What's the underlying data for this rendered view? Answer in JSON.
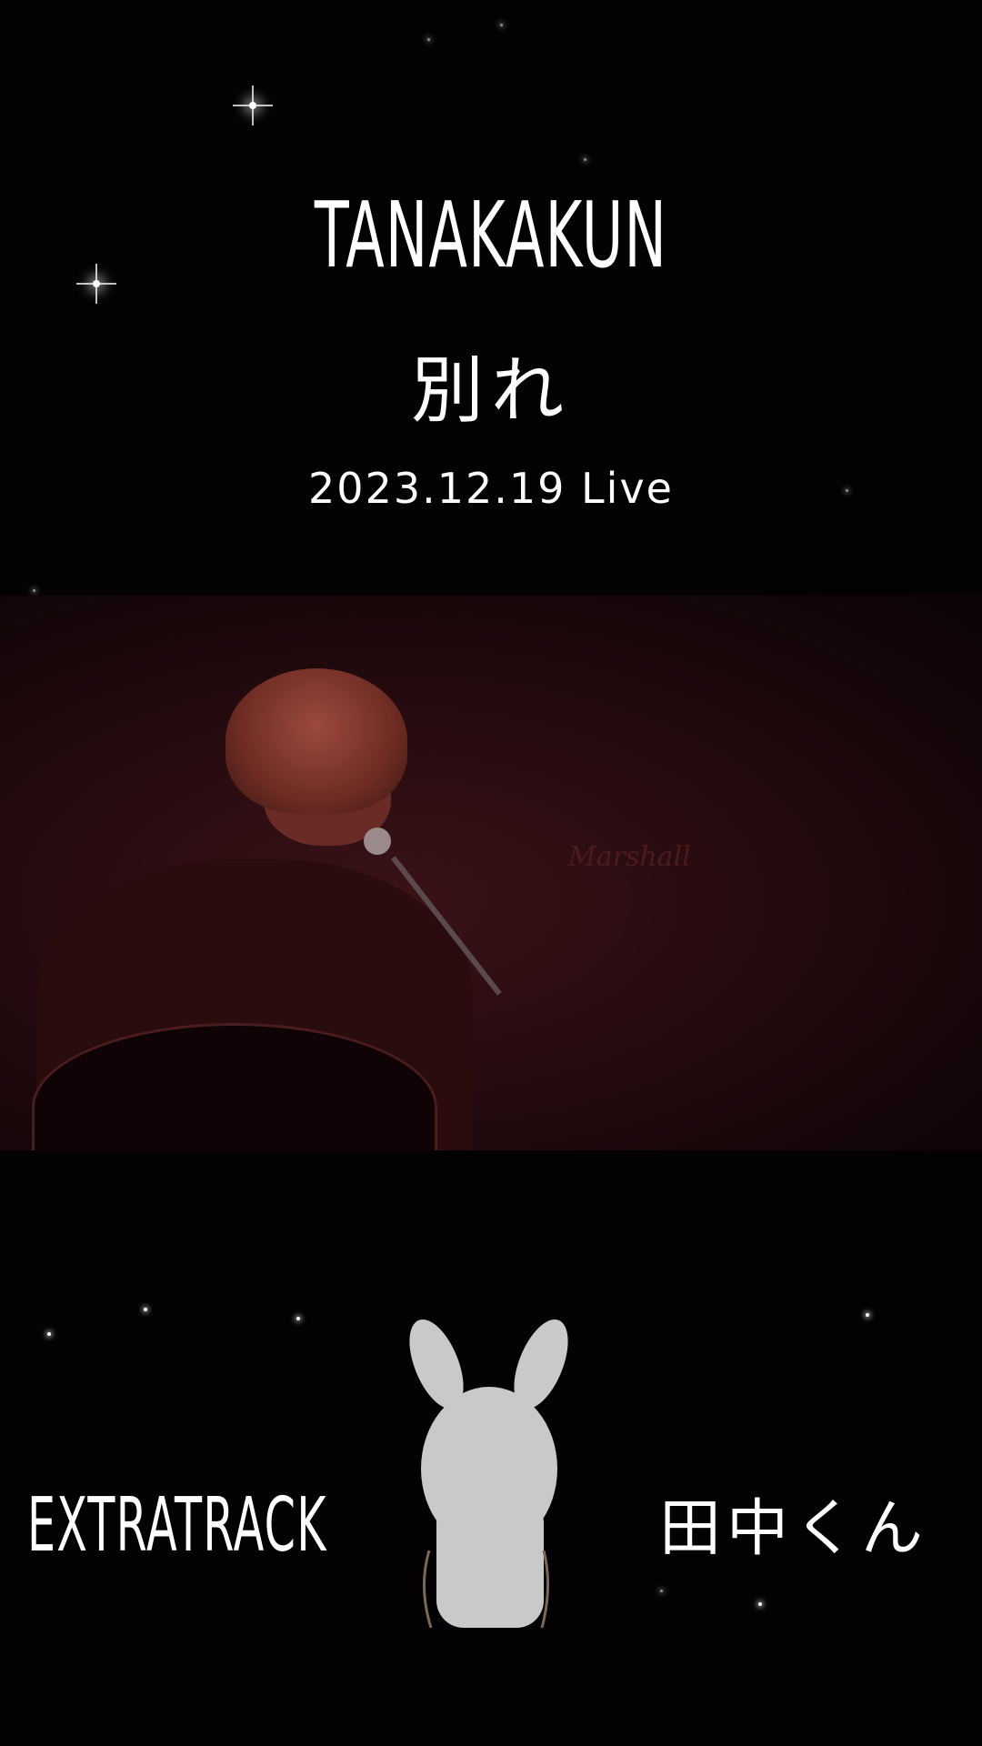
{
  "title": "TANAKAKUN",
  "subtitle_jp": "別れ",
  "date": "2023.12.19 Live",
  "video": {
    "amp_brand": "Marshall"
  },
  "footer": {
    "left_label": "EXTRATRACK",
    "right_label": "田中くん"
  },
  "icons": {
    "mascot": "bunny-icon",
    "stars": "star-icon"
  },
  "colors": {
    "background": "#030103",
    "text": "#ffffff",
    "video_tint": "#250b0f"
  }
}
